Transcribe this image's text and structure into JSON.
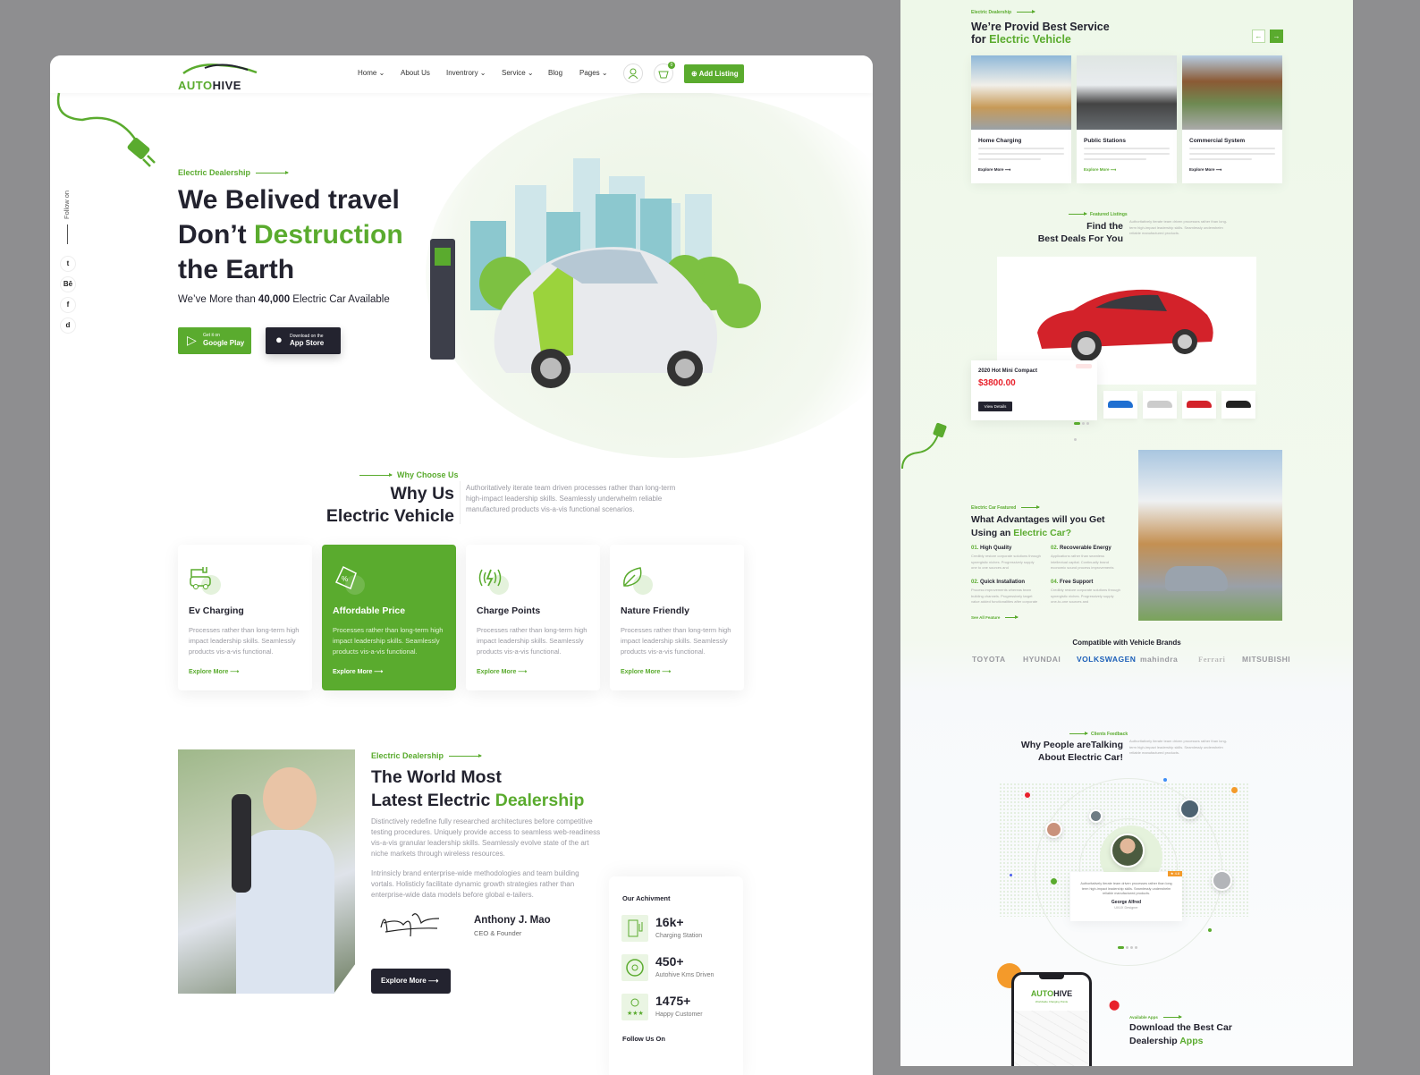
{
  "colors": {
    "accent": "#5aab2e",
    "dark": "#23232f",
    "price": "#e8212b",
    "background": "#8e8e90"
  },
  "logo": {
    "text_a": "AUTO",
    "text_b": "HIVE"
  },
  "nav": {
    "items": [
      {
        "label": "Home",
        "dropdown": true
      },
      {
        "label": "About Us",
        "dropdown": false
      },
      {
        "label": "Inventrory",
        "dropdown": true
      },
      {
        "label": "Service",
        "dropdown": true
      },
      {
        "label": "Blog",
        "dropdown": false
      },
      {
        "label": "Pages",
        "dropdown": true
      }
    ],
    "cart_count": "0",
    "add_listing": "Add Listing",
    "icons": [
      "user-icon",
      "cart-icon",
      "plus-circle-icon"
    ]
  },
  "sidebar": {
    "follow": "Follow on",
    "socials": [
      {
        "icon": "twitter-icon",
        "glyph": "t"
      },
      {
        "icon": "behance-icon",
        "glyph": "Bē"
      },
      {
        "icon": "facebook-icon",
        "glyph": "f"
      },
      {
        "icon": "discord-icon",
        "glyph": "d"
      }
    ]
  },
  "hero": {
    "label": "Electric Dealership",
    "line1": "We Belived travel",
    "line2a": "Don’t ",
    "line2b": "Destruction",
    "line3": "the Earth",
    "sub_a": "We’ve More than ",
    "sub_b": "40,000",
    "sub_c": " Electric Car Available",
    "google_small": "Get it on",
    "google_big": "Google Play",
    "apple_small": "Download on the",
    "apple_big": "App Store"
  },
  "why": {
    "label": "Why Choose Us",
    "title1": "Why Us",
    "title2": "Electric Vehicle",
    "desc": "Authoritatively iterate team driven processes rather than long-term high-impact leadership skills. Seamlessly underwhelm reliable manufactured products vis-a-vis functional scenarios.",
    "cards": [
      {
        "title": "Ev Charging",
        "icon": "ev-charging-icon",
        "text": "Processes rather than long-term high impact leadership skills. Seamlessly products vis-a-vis functional.",
        "link": "Explore More",
        "active": false
      },
      {
        "title": "Affordable Price",
        "icon": "price-tag-icon",
        "text": "Processes rather than long-term high impact leadership skills. Seamlessly products vis-a-vis functional.",
        "link": "Explore More",
        "active": true
      },
      {
        "title": "Charge Points",
        "icon": "charge-point-icon",
        "text": "Processes rather than long-term high impact leadership skills. Seamlessly products vis-a-vis functional.",
        "link": "Explore More",
        "active": false
      },
      {
        "title": "Nature Friendly",
        "icon": "leaf-icon",
        "text": "Processes rather than long-term high impact leadership skills. Seamlessly products vis-a-vis functional.",
        "link": "Explore More",
        "active": false
      }
    ]
  },
  "about": {
    "label": "Electric Dealership",
    "title1": "The World Most",
    "title2a": "Latest Electric ",
    "title2b": "Dealership",
    "p1": "Distinctively redefine fully researched architectures before competitive testing procedures. Uniquely provide access to seamless web-readiness vis-a-vis granular leadership skills. Seamlessly evolve state of the art niche markets through wireless resources.",
    "p2": "Intrinsicly brand enterprise-wide methodologies and team building vortals. Holisticly facilitate dynamic growth strategies rather than enterprise-wide data models before global e-tailers.",
    "signature": "Henry James",
    "name": "Anthony J. Mao",
    "role": "CEO & Founder",
    "button": "Explore More"
  },
  "achievement": {
    "title": "Our Achivment",
    "stats": [
      {
        "value": "16k+",
        "label": "Charging Station",
        "icon": "charging-station-icon"
      },
      {
        "value": "450+",
        "label": "Autohive Kms Driven",
        "icon": "steering-wheel-icon"
      },
      {
        "value": "1475+",
        "label": "Happy Customer",
        "icon": "customer-icon"
      }
    ],
    "follow": "Follow Us On"
  },
  "services": {
    "label": "Electric Dealership",
    "title1": "We’re Provid Best Service",
    "title2a": "for ",
    "title2b": "Electric Vehicle",
    "items": [
      {
        "title": "Home Charging",
        "link": "Explore More"
      },
      {
        "title": "Public Stations",
        "link": "Explore More"
      },
      {
        "title": "Commercial System",
        "link": "Explore More"
      }
    ]
  },
  "featured": {
    "label": "Featured Listings",
    "title1": "Find the",
    "title2": "Best Deals For You",
    "desc": "Authoritatively iterate team driven processes rather than long-term high-impact leadership skills. Seamlessly underwhelm reliable manufactured products.",
    "car": {
      "name": "2020 Hot Mini Compact",
      "price": "$3800.00",
      "button": "View Details"
    },
    "slide_total": 4,
    "slide_active": 1
  },
  "advantages": {
    "label": "Electric Car Featured",
    "title1": "What Advantages will you Get",
    "title2a": "Using an ",
    "title2b": "Electric Car?",
    "items": [
      {
        "num": "01.",
        "title": "High Quality",
        "text": "Credibly restore corporate solutions through synergistic niches. Progressively supply one to one sources and"
      },
      {
        "num": "02.",
        "title": "Recoverable Energy",
        "text": "Applications rather than seamless intellectual capital. Continually brand economic sound process improvements"
      },
      {
        "num": "02.",
        "title": "Quick Installation",
        "text": "Process improvements whereas team building channels. Progressively target value added functionalities after corporate"
      },
      {
        "num": "04.",
        "title": "Free Support",
        "text": "Credibly restore corporate solutions through synergistic niches. Progressively supply one-to-one sources and"
      }
    ],
    "link": "See All Feature"
  },
  "brands": {
    "title": "Compatible with Vehicle Brands",
    "items": [
      "TOYOTA",
      "HYUNDAI",
      "VOLKSWAGEN",
      "mahindra",
      "Ferrari",
      "MITSUBISHI"
    ]
  },
  "testimonials": {
    "label": "Clients Feedback",
    "title1": "Why People areTalking",
    "title2": "About Electric Car!",
    "desc": "Authoritatively iterate team driven processes rather than long-term high-impact leadership skills. Seamlessly underwhelm reliable manufactured products.",
    "rating": "4.8",
    "quote": "Authoritatively iterate team driven processes rather than long term high-impact leadership skills. Seamlessly underwhelm reliable manufactured products.",
    "name": "George Alfred",
    "role": "UI/UX Designer",
    "slide_total": 4,
    "slide_active": 1
  },
  "app": {
    "phone_logo": "AUTOHIVE",
    "phone_tag": "Worldwide Charging Points",
    "label": "Available Apps",
    "title1": "Download the Best Car",
    "title2a": "Dealership ",
    "title2b": "Apps"
  }
}
